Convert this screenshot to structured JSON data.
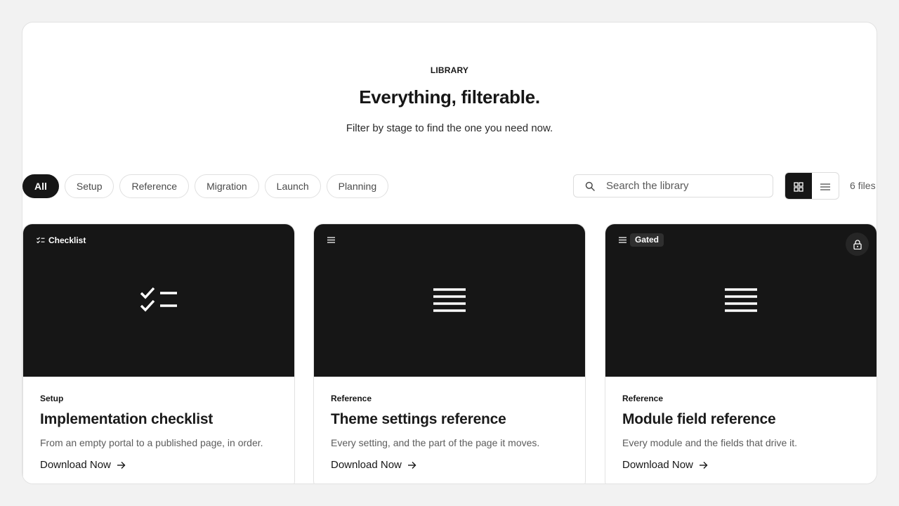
{
  "hero": {
    "eyebrow": "LIBRARY",
    "title": "Everything, filterable.",
    "subtitle": "Filter by stage to find the one you need now."
  },
  "filters": [
    {
      "label": "All",
      "active": true
    },
    {
      "label": "Setup",
      "active": false
    },
    {
      "label": "Reference",
      "active": false
    },
    {
      "label": "Migration",
      "active": false
    },
    {
      "label": "Launch",
      "active": false
    },
    {
      "label": "Planning",
      "active": false
    }
  ],
  "search": {
    "placeholder": "Search the library",
    "icon": "search-icon"
  },
  "view_toggle": {
    "selected": "grid",
    "options": [
      "grid",
      "list"
    ]
  },
  "file_count": "6 files",
  "cards": [
    {
      "badge_icon": "checklist-icon",
      "badge_label": "Checklist",
      "gated": false,
      "center_icon": "checklist-icon",
      "category": "Setup",
      "title": "Implementation checklist",
      "description": "From an empty portal to a published page, in order.",
      "cta": "Download Now"
    },
    {
      "badge_icon": "lines-icon",
      "badge_label": "",
      "gated": false,
      "center_icon": "lines-icon",
      "category": "Reference",
      "title": "Theme settings reference",
      "description": "Every setting, and the part of the page it moves.",
      "cta": "Download Now"
    },
    {
      "badge_icon": "lines-icon",
      "badge_label": "Gated",
      "gated": true,
      "center_icon": "lines-icon",
      "category": "Reference",
      "title": "Module field reference",
      "description": "Every module and the fields that drive it.",
      "cta": "Download Now"
    }
  ],
  "colors": {
    "background": "#f2f2f2",
    "surface": "#ffffff",
    "ink": "#161616",
    "muted": "#5c5c5c",
    "border": "#e2e2e2"
  }
}
